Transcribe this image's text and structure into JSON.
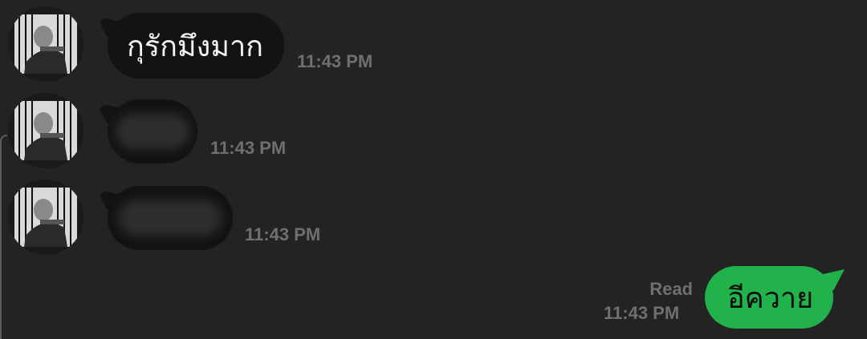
{
  "messages": [
    {
      "direction": "incoming",
      "text": "กุรักมึงมาก",
      "time": "11:43 PM",
      "avatar": "avatar-photo-bw"
    },
    {
      "direction": "incoming",
      "text": "",
      "time": "11:43 PM",
      "avatar": "avatar-photo-bw",
      "redacted": true
    },
    {
      "direction": "incoming",
      "text": "",
      "time": "11:43 PM",
      "avatar": "avatar-photo-bw",
      "redacted": true
    },
    {
      "direction": "outgoing",
      "text": "อีควาย",
      "time": "11:43 PM",
      "status": "Read"
    }
  ],
  "colors": {
    "background": "#232323",
    "incoming_bubble": "#131313",
    "outgoing_bubble": "#22b24c",
    "timestamp": "#6f6f6f"
  }
}
